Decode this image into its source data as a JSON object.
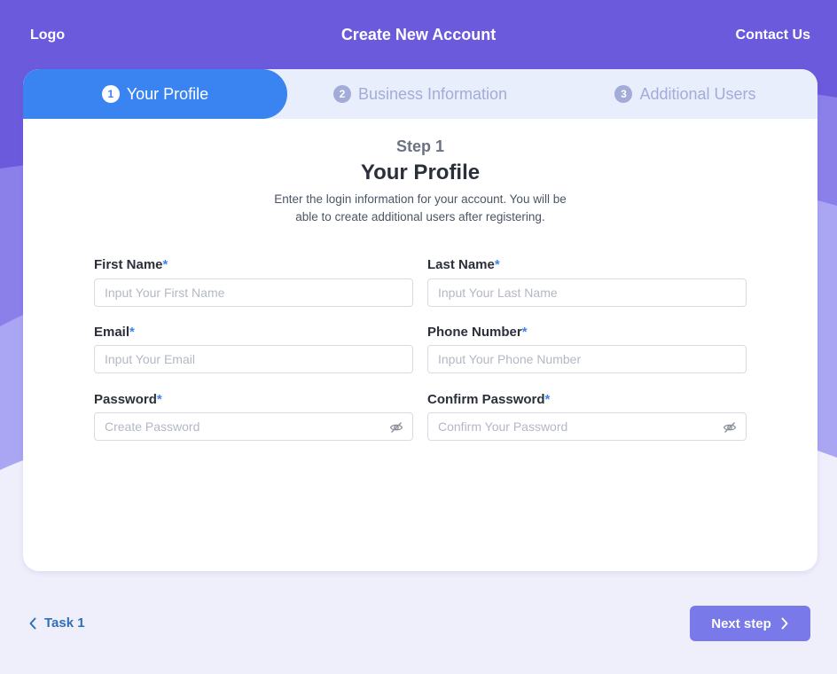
{
  "header": {
    "logo": "Logo",
    "title": "Create New Account",
    "contact": "Contact Us"
  },
  "tabs": [
    {
      "number": "1",
      "label": "Your Profile",
      "active": true
    },
    {
      "number": "2",
      "label": "Business Information",
      "active": false
    },
    {
      "number": "3",
      "label": "Additional Users",
      "active": false
    }
  ],
  "step": {
    "label": "Step 1",
    "title": "Your Profile",
    "description": "Enter the login information for your account. You will be able to create additional users after registering."
  },
  "form": {
    "first_name": {
      "label": "First Name",
      "required": "*",
      "placeholder": "Input Your First Name",
      "value": ""
    },
    "last_name": {
      "label": "Last Name",
      "required": "*",
      "placeholder": "Input Your Last Name",
      "value": ""
    },
    "email": {
      "label": "Email",
      "required": "*",
      "placeholder": "Input Your Email",
      "value": ""
    },
    "phone": {
      "label": "Phone Number",
      "required": "*",
      "placeholder": "Input Your Phone Number",
      "value": ""
    },
    "password": {
      "label": "Password",
      "required": "*",
      "placeholder": "Create Password",
      "value": "",
      "icon": "eye-off-icon"
    },
    "confirm_password": {
      "label": "Confirm Password",
      "required": "*",
      "placeholder": "Confirm Your Password",
      "value": "",
      "icon": "eye-off-icon"
    }
  },
  "footer": {
    "back_label": "Task 1",
    "next_label": "Next step"
  },
  "colors": {
    "header_purple": "#6b5bdc",
    "accent_blue": "#3a84f2",
    "next_button": "#7a79ea",
    "tab_inactive": "#a3acd6",
    "back_link": "#2f6fb5"
  }
}
